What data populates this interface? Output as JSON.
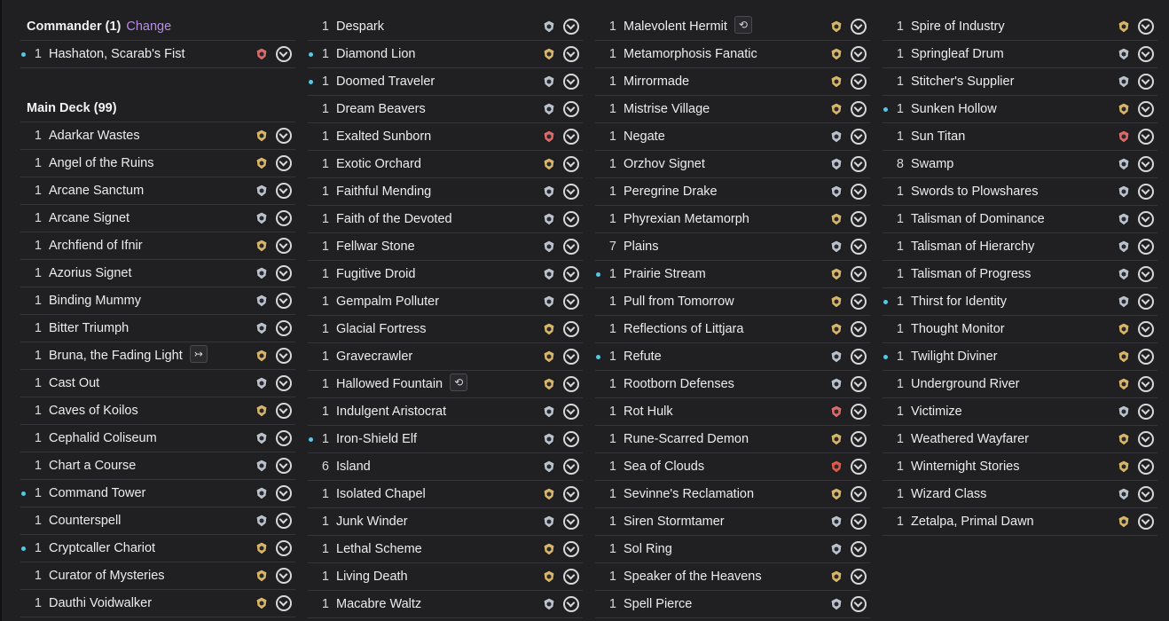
{
  "commander": {
    "label": "Commander (1)",
    "change_label": "Change",
    "cards": [
      {
        "qty": "1",
        "name": "Hashaton, Scarab's Fist",
        "dot": true,
        "icon": "shield-rarity-icon",
        "color": "#d86a6a"
      }
    ]
  },
  "main_deck": {
    "label": "Main Deck (99)"
  },
  "columns": [
    {
      "cards": [
        {
          "qty": "1",
          "name": "Adarkar Wastes",
          "dot": false,
          "icon": "set-symbol-icon",
          "color": "#d6b468"
        },
        {
          "qty": "1",
          "name": "Angel of the Ruins",
          "dot": false,
          "icon": "set-symbol-icon",
          "color": "#d6b468"
        },
        {
          "qty": "1",
          "name": "Arcane Sanctum",
          "dot": false,
          "icon": "set-symbol-icon",
          "color": "#b9c2cc"
        },
        {
          "qty": "1",
          "name": "Arcane Signet",
          "dot": false,
          "icon": "set-symbol-icon",
          "color": "#b9c2cc"
        },
        {
          "qty": "1",
          "name": "Archfiend of Ifnir",
          "dot": false,
          "icon": "set-symbol-icon",
          "color": "#d6b468"
        },
        {
          "qty": "1",
          "name": "Azorius Signet",
          "dot": false,
          "icon": "set-symbol-icon",
          "color": "#b9c2cc"
        },
        {
          "qty": "1",
          "name": "Binding Mummy",
          "dot": false,
          "icon": "set-symbol-icon",
          "color": "#b9c2cc"
        },
        {
          "qty": "1",
          "name": "Bitter Triumph",
          "dot": false,
          "icon": "set-symbol-icon",
          "color": "#b9c2cc"
        },
        {
          "qty": "1",
          "name": "Bruna, the Fading Light",
          "dot": false,
          "icon": "set-symbol-icon",
          "color": "#d6b468",
          "tag": "↣"
        },
        {
          "qty": "1",
          "name": "Cast Out",
          "dot": false,
          "icon": "set-symbol-icon",
          "color": "#b9c2cc"
        },
        {
          "qty": "1",
          "name": "Caves of Koilos",
          "dot": false,
          "icon": "set-symbol-icon",
          "color": "#d6b468"
        },
        {
          "qty": "1",
          "name": "Cephalid Coliseum",
          "dot": false,
          "icon": "set-symbol-icon",
          "color": "#b9c2cc"
        },
        {
          "qty": "1",
          "name": "Chart a Course",
          "dot": false,
          "icon": "set-symbol-icon",
          "color": "#b9c2cc"
        },
        {
          "qty": "1",
          "name": "Command Tower",
          "dot": true,
          "icon": "set-symbol-icon",
          "color": "#b9c2cc"
        },
        {
          "qty": "1",
          "name": "Counterspell",
          "dot": false,
          "icon": "set-symbol-icon",
          "color": "#b9c2cc"
        },
        {
          "qty": "1",
          "name": "Cryptcaller Chariot",
          "dot": true,
          "icon": "set-symbol-icon",
          "color": "#d6b468"
        },
        {
          "qty": "1",
          "name": "Curator of Mysteries",
          "dot": false,
          "icon": "set-symbol-icon",
          "color": "#d6b468"
        },
        {
          "qty": "1",
          "name": "Dauthi Voidwalker",
          "dot": false,
          "icon": "set-symbol-icon",
          "color": "#d6b468"
        }
      ]
    },
    {
      "cards": [
        {
          "qty": "1",
          "name": "Despark",
          "dot": false,
          "icon": "set-symbol-icon",
          "color": "#b9c2cc"
        },
        {
          "qty": "1",
          "name": "Diamond Lion",
          "dot": true,
          "icon": "set-symbol-icon",
          "color": "#d6b468"
        },
        {
          "qty": "1",
          "name": "Doomed Traveler",
          "dot": true,
          "icon": "set-symbol-icon",
          "color": "#b9c2cc"
        },
        {
          "qty": "1",
          "name": "Dream Beavers",
          "dot": false,
          "icon": "set-symbol-icon",
          "color": "#b9c2cc"
        },
        {
          "qty": "1",
          "name": "Exalted Sunborn",
          "dot": false,
          "icon": "set-symbol-icon",
          "color": "#d86a6a"
        },
        {
          "qty": "1",
          "name": "Exotic Orchard",
          "dot": false,
          "icon": "set-symbol-icon",
          "color": "#d6b468"
        },
        {
          "qty": "1",
          "name": "Faithful Mending",
          "dot": false,
          "icon": "set-symbol-icon",
          "color": "#b9c2cc"
        },
        {
          "qty": "1",
          "name": "Faith of the Devoted",
          "dot": false,
          "icon": "set-symbol-icon",
          "color": "#b9c2cc"
        },
        {
          "qty": "1",
          "name": "Fellwar Stone",
          "dot": false,
          "icon": "set-symbol-icon",
          "color": "#b9c2cc"
        },
        {
          "qty": "1",
          "name": "Fugitive Droid",
          "dot": false,
          "icon": "set-symbol-icon",
          "color": "#b9c2cc"
        },
        {
          "qty": "1",
          "name": "Gempalm Polluter",
          "dot": false,
          "icon": "set-symbol-icon",
          "color": "#b9c2cc"
        },
        {
          "qty": "1",
          "name": "Glacial Fortress",
          "dot": false,
          "icon": "set-symbol-icon",
          "color": "#d6b468"
        },
        {
          "qty": "1",
          "name": "Gravecrawler",
          "dot": false,
          "icon": "set-symbol-icon",
          "color": "#d6b468"
        },
        {
          "qty": "1",
          "name": "Hallowed Fountain",
          "dot": false,
          "icon": "set-symbol-icon",
          "color": "#d6b468",
          "tag": "⟲"
        },
        {
          "qty": "1",
          "name": "Indulgent Aristocrat",
          "dot": false,
          "icon": "set-symbol-icon",
          "color": "#b9c2cc"
        },
        {
          "qty": "1",
          "name": "Iron-Shield Elf",
          "dot": true,
          "icon": "set-symbol-icon",
          "color": "#b9c2cc"
        },
        {
          "qty": "6",
          "name": "Island",
          "dot": false,
          "icon": "set-symbol-icon",
          "color": "#b9c2cc"
        },
        {
          "qty": "1",
          "name": "Isolated Chapel",
          "dot": false,
          "icon": "set-symbol-icon",
          "color": "#d6b468"
        },
        {
          "qty": "1",
          "name": "Junk Winder",
          "dot": false,
          "icon": "set-symbol-icon",
          "color": "#b9c2cc"
        },
        {
          "qty": "1",
          "name": "Lethal Scheme",
          "dot": false,
          "icon": "set-symbol-icon",
          "color": "#d6b468"
        },
        {
          "qty": "1",
          "name": "Living Death",
          "dot": false,
          "icon": "set-symbol-icon",
          "color": "#d6b468"
        },
        {
          "qty": "1",
          "name": "Macabre Waltz",
          "dot": false,
          "icon": "set-symbol-icon",
          "color": "#b9c2cc"
        }
      ]
    },
    {
      "cards": [
        {
          "qty": "1",
          "name": "Malevolent Hermit",
          "dot": false,
          "icon": "set-symbol-icon",
          "color": "#d6b468",
          "tag": "⟲"
        },
        {
          "qty": "1",
          "name": "Metamorphosis Fanatic",
          "dot": false,
          "icon": "set-symbol-icon",
          "color": "#d6b468"
        },
        {
          "qty": "1",
          "name": "Mirrormade",
          "dot": false,
          "icon": "set-symbol-icon",
          "color": "#d6b468"
        },
        {
          "qty": "1",
          "name": "Mistrise Village",
          "dot": false,
          "icon": "set-symbol-icon",
          "color": "#d6b468"
        },
        {
          "qty": "1",
          "name": "Negate",
          "dot": false,
          "icon": "set-symbol-icon",
          "color": "#b9c2cc"
        },
        {
          "qty": "1",
          "name": "Orzhov Signet",
          "dot": false,
          "icon": "set-symbol-icon",
          "color": "#b9c2cc"
        },
        {
          "qty": "1",
          "name": "Peregrine Drake",
          "dot": false,
          "icon": "set-symbol-icon",
          "color": "#b9c2cc"
        },
        {
          "qty": "1",
          "name": "Phyrexian Metamorph",
          "dot": false,
          "icon": "set-symbol-icon",
          "color": "#d6b468"
        },
        {
          "qty": "7",
          "name": "Plains",
          "dot": false,
          "icon": "set-symbol-icon",
          "color": "#b9c2cc"
        },
        {
          "qty": "1",
          "name": "Prairie Stream",
          "dot": true,
          "icon": "set-symbol-icon",
          "color": "#d6b468"
        },
        {
          "qty": "1",
          "name": "Pull from Tomorrow",
          "dot": false,
          "icon": "set-symbol-icon",
          "color": "#d6b468"
        },
        {
          "qty": "1",
          "name": "Reflections of Littjara",
          "dot": false,
          "icon": "set-symbol-icon",
          "color": "#d6b468"
        },
        {
          "qty": "1",
          "name": "Refute",
          "dot": true,
          "icon": "set-symbol-icon",
          "color": "#b9c2cc"
        },
        {
          "qty": "1",
          "name": "Rootborn Defenses",
          "dot": false,
          "icon": "set-symbol-icon",
          "color": "#b9c2cc"
        },
        {
          "qty": "1",
          "name": "Rot Hulk",
          "dot": false,
          "icon": "set-symbol-icon",
          "color": "#d86a6a"
        },
        {
          "qty": "1",
          "name": "Rune-Scarred Demon",
          "dot": false,
          "icon": "set-symbol-icon",
          "color": "#d6b468"
        },
        {
          "qty": "1",
          "name": "Sea of Clouds",
          "dot": false,
          "icon": "set-symbol-icon",
          "color": "#e05a4a"
        },
        {
          "qty": "1",
          "name": "Sevinne's Reclamation",
          "dot": false,
          "icon": "set-symbol-icon",
          "color": "#d6b468"
        },
        {
          "qty": "1",
          "name": "Siren Stormtamer",
          "dot": false,
          "icon": "set-symbol-icon",
          "color": "#b9c2cc"
        },
        {
          "qty": "1",
          "name": "Sol Ring",
          "dot": false,
          "icon": "set-symbol-icon",
          "color": "#b9c2cc"
        },
        {
          "qty": "1",
          "name": "Speaker of the Heavens",
          "dot": false,
          "icon": "set-symbol-icon",
          "color": "#d6b468"
        },
        {
          "qty": "1",
          "name": "Spell Pierce",
          "dot": false,
          "icon": "set-symbol-icon",
          "color": "#b9c2cc"
        }
      ]
    },
    {
      "cards": [
        {
          "qty": "1",
          "name": "Spire of Industry",
          "dot": false,
          "icon": "set-symbol-icon",
          "color": "#d6b468"
        },
        {
          "qty": "1",
          "name": "Springleaf Drum",
          "dot": false,
          "icon": "set-symbol-icon",
          "color": "#b9c2cc"
        },
        {
          "qty": "1",
          "name": "Stitcher's Supplier",
          "dot": false,
          "icon": "set-symbol-icon",
          "color": "#b9c2cc"
        },
        {
          "qty": "1",
          "name": "Sunken Hollow",
          "dot": true,
          "icon": "set-symbol-icon",
          "color": "#d6b468"
        },
        {
          "qty": "1",
          "name": "Sun Titan",
          "dot": false,
          "icon": "set-symbol-icon",
          "color": "#d86a6a"
        },
        {
          "qty": "8",
          "name": "Swamp",
          "dot": false,
          "icon": "set-symbol-icon",
          "color": "#b9c2cc"
        },
        {
          "qty": "1",
          "name": "Swords to Plowshares",
          "dot": false,
          "icon": "set-symbol-icon",
          "color": "#b9c2cc"
        },
        {
          "qty": "1",
          "name": "Talisman of Dominance",
          "dot": false,
          "icon": "set-symbol-icon",
          "color": "#b9c2cc"
        },
        {
          "qty": "1",
          "name": "Talisman of Hierarchy",
          "dot": false,
          "icon": "set-symbol-icon",
          "color": "#b9c2cc"
        },
        {
          "qty": "1",
          "name": "Talisman of Progress",
          "dot": false,
          "icon": "set-symbol-icon",
          "color": "#b9c2cc"
        },
        {
          "qty": "1",
          "name": "Thirst for Identity",
          "dot": true,
          "icon": "set-symbol-icon",
          "color": "#b9c2cc"
        },
        {
          "qty": "1",
          "name": "Thought Monitor",
          "dot": false,
          "icon": "set-symbol-icon",
          "color": "#d6b468"
        },
        {
          "qty": "1",
          "name": "Twilight Diviner",
          "dot": true,
          "icon": "set-symbol-icon",
          "color": "#d6b468"
        },
        {
          "qty": "1",
          "name": "Underground River",
          "dot": false,
          "icon": "set-symbol-icon",
          "color": "#d6b468"
        },
        {
          "qty": "1",
          "name": "Victimize",
          "dot": false,
          "icon": "set-symbol-icon",
          "color": "#b9c2cc"
        },
        {
          "qty": "1",
          "name": "Weathered Wayfarer",
          "dot": false,
          "icon": "set-symbol-icon",
          "color": "#d6b468"
        },
        {
          "qty": "1",
          "name": "Winternight Stories",
          "dot": false,
          "icon": "set-symbol-icon",
          "color": "#d6b468"
        },
        {
          "qty": "1",
          "name": "Wizard Class",
          "dot": false,
          "icon": "set-symbol-icon",
          "color": "#b9c2cc"
        },
        {
          "qty": "1",
          "name": "Zetalpa, Primal Dawn",
          "dot": false,
          "icon": "set-symbol-icon",
          "color": "#d6b468"
        }
      ]
    }
  ],
  "colors": {
    "background": "#202023",
    "divider": "#34343a",
    "accent_link": "#b88ce6",
    "dot": "#55c8e4"
  }
}
